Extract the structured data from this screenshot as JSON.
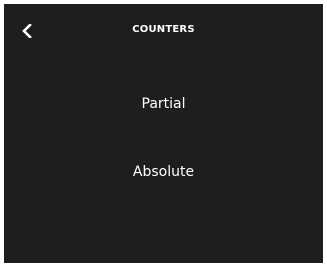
{
  "header": {
    "title": "COUNTERS",
    "back_icon": "chevron-left-icon"
  },
  "menu": {
    "items": [
      {
        "label": "Partial"
      },
      {
        "label": "Absolute"
      }
    ]
  },
  "colors": {
    "background": "#1f1e1d",
    "text": "#ffffff"
  }
}
